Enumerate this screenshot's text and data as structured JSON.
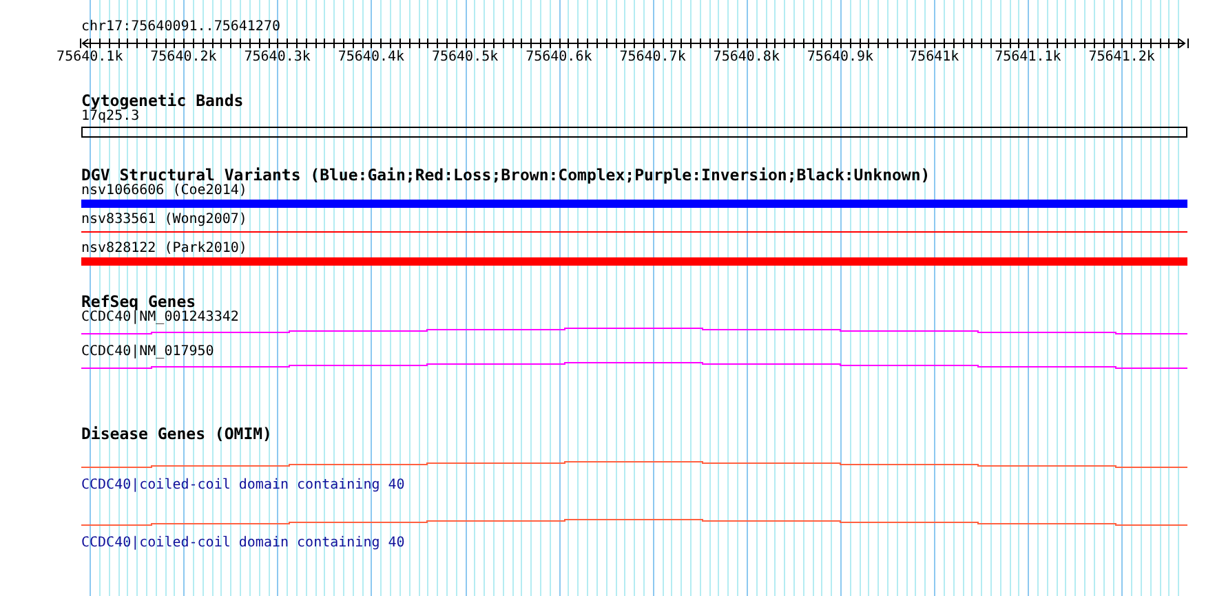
{
  "location": "chr17:75640091..75641270",
  "ruler": {
    "labels": [
      "75640.1k",
      "75640.2k",
      "75640.3k",
      "75640.4k",
      "75640.5k",
      "75640.6k",
      "75640.7k",
      "75640.8k",
      "75640.9k",
      "75641k",
      "75641.1k",
      "75641.2k"
    ]
  },
  "tracks": [
    {
      "kind": "cytoband",
      "title": "Cytogenetic Bands",
      "features": [
        {
          "label": "17q25.3"
        }
      ]
    },
    {
      "kind": "variant",
      "title": "DGV Structural Variants (Blue:Gain;Red:Loss;Brown:Complex;Purple:Inversion;Black:Unknown)",
      "features": [
        {
          "label": "nsv1066606 (Coe2014)",
          "kind": "thick",
          "color": "#0000ff"
        },
        {
          "label": "nsv833561 (Wong2007)",
          "kind": "thin",
          "color": "#ff0000"
        },
        {
          "label": "nsv828122 (Park2010)",
          "kind": "thick",
          "color": "#ff0000"
        }
      ]
    },
    {
      "kind": "gene",
      "title": "RefSeq Genes",
      "features": [
        {
          "label": "CCDC40|NM_001243342"
        },
        {
          "label": "CCDC40|NM_017950"
        }
      ]
    },
    {
      "kind": "disease",
      "title": "Disease Genes (OMIM)",
      "features": [
        {
          "label": "CCDC40|coiled-coil domain containing 40"
        },
        {
          "label": "CCDC40|coiled-coil domain containing 40"
        }
      ]
    }
  ]
}
